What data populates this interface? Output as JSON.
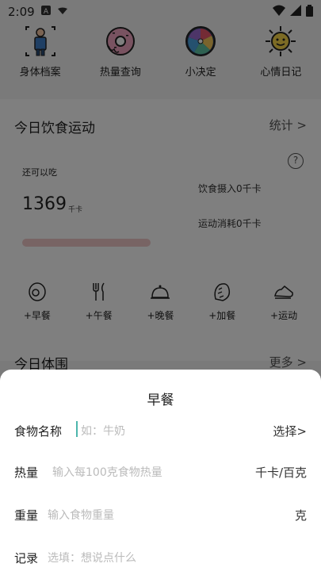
{
  "status_bar": {
    "time": "2:09"
  },
  "top_nav": [
    {
      "label": "身体档案",
      "icon": "body-profile-icon"
    },
    {
      "label": "热量查询",
      "icon": "donut-icon"
    },
    {
      "label": "小决定",
      "icon": "spinner-wheel-icon"
    },
    {
      "label": "心情日记",
      "icon": "sun-icon"
    }
  ],
  "today_diet": {
    "title": "今日饮食运动",
    "stats_link": "统计 >",
    "help": "?",
    "remain_label": "还可以吃",
    "remain_value": "1369",
    "remain_unit": "千卡",
    "intake": "饮食摄入0千卡",
    "burn": "运动消耗0千卡"
  },
  "meals": [
    {
      "label": "+早餐",
      "icon": "egg-icon"
    },
    {
      "label": "+午餐",
      "icon": "fork-knife-icon"
    },
    {
      "label": "+晚餐",
      "icon": "cloche-icon"
    },
    {
      "label": "+加餐",
      "icon": "bread-icon"
    },
    {
      "label": "+运动",
      "icon": "sneaker-icon"
    }
  ],
  "today_body": {
    "title": "今日体围",
    "more_link": "更多 >"
  },
  "sheet": {
    "title": "早餐",
    "food_name": {
      "label": "食物名称",
      "placeholder": "如：牛奶",
      "action": "选择>"
    },
    "calorie": {
      "label": "热量",
      "placeholder": "输入每100克食物热量",
      "unit": "千卡/百克"
    },
    "weight": {
      "label": "重量",
      "placeholder": "输入食物重量",
      "unit": "克"
    },
    "note": {
      "label": "记录",
      "placeholder": "选填：想说点什么"
    }
  },
  "colors": {
    "accent": "#4db6ac",
    "progress": "#f0c9c9"
  }
}
